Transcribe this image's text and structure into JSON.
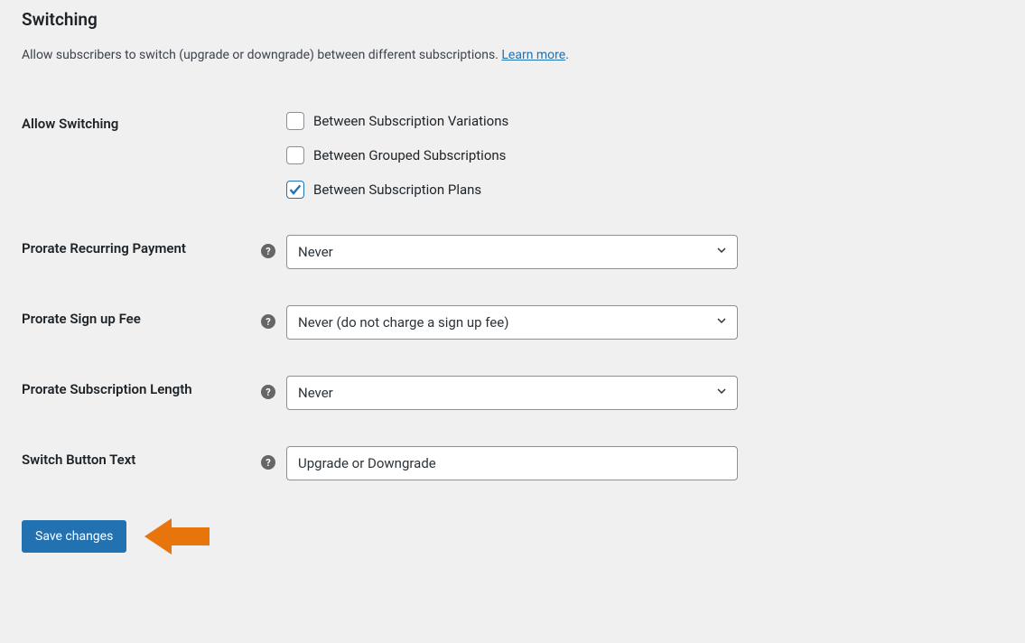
{
  "section": {
    "title": "Switching",
    "description": "Allow subscribers to switch (upgrade or downgrade) between different subscriptions. ",
    "learn_more": "Learn more",
    "period": "."
  },
  "rows": {
    "allow_switching": {
      "label": "Allow Switching",
      "options": [
        {
          "label": "Between Subscription Variations",
          "checked": false
        },
        {
          "label": "Between Grouped Subscriptions",
          "checked": false
        },
        {
          "label": "Between Subscription Plans",
          "checked": true
        }
      ]
    },
    "prorate_recurring": {
      "label": "Prorate Recurring Payment",
      "value": "Never"
    },
    "prorate_signup": {
      "label": "Prorate Sign up Fee",
      "value": "Never (do not charge a sign up fee)"
    },
    "prorate_length": {
      "label": "Prorate Subscription Length",
      "value": "Never"
    },
    "switch_button_text": {
      "label": "Switch Button Text",
      "value": "Upgrade or Downgrade"
    }
  },
  "actions": {
    "save": "Save changes"
  },
  "icons": {
    "help": "?"
  }
}
